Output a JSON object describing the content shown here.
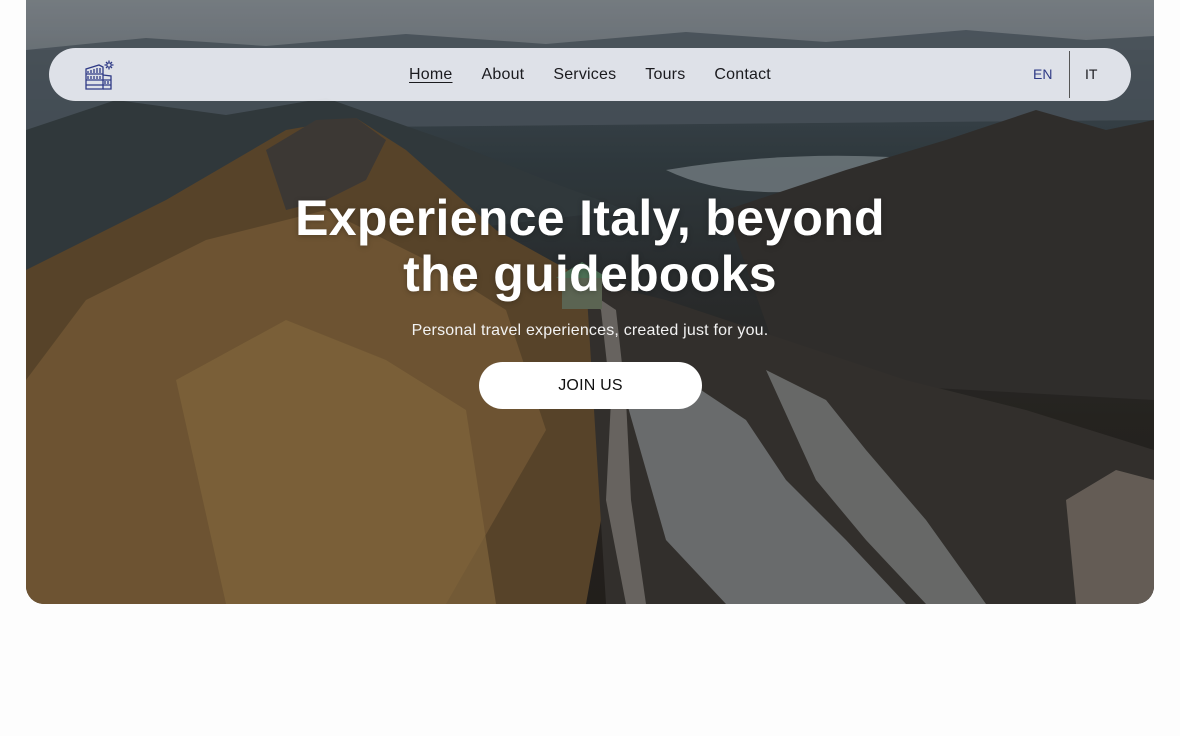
{
  "nav": {
    "logo_icon": "colosseum-sun-icon",
    "links": [
      {
        "label": "Home",
        "active": true
      },
      {
        "label": "About"
      },
      {
        "label": "Services"
      },
      {
        "label": "Tours"
      },
      {
        "label": "Contact"
      }
    ],
    "languages": [
      "EN",
      "IT"
    ],
    "selected_language": "EN"
  },
  "hero": {
    "image": "mountain-ridge-landscape",
    "headline_line1": "Experience Italy, beyond",
    "headline_line2": "the guidebooks",
    "subheadline": "Personal travel experiences, created just for you.",
    "cta_label": "JOIN US"
  },
  "colors": {
    "accent": "#2f3a86",
    "navbar_bg": "#eceef4",
    "cta_bg": "#ffffff",
    "page_bg": "#fdfdfd"
  }
}
